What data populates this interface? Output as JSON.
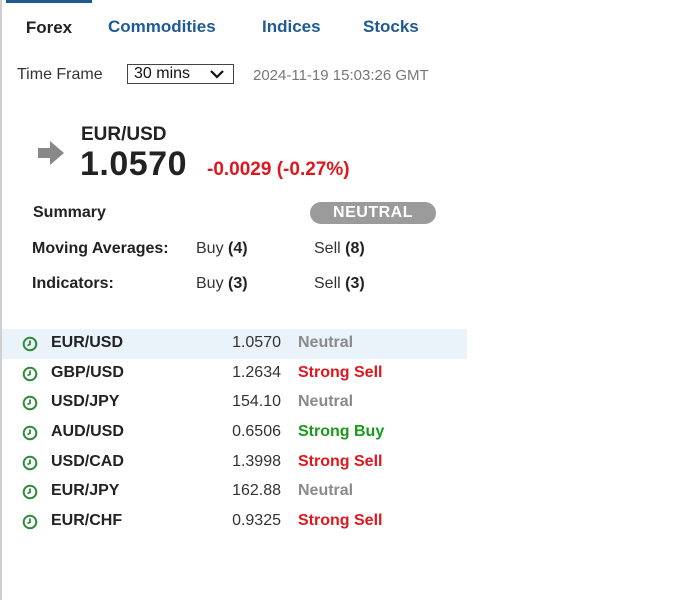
{
  "tabs": [
    {
      "label": "Forex",
      "active": true
    },
    {
      "label": "Commodities",
      "active": false
    },
    {
      "label": "Indices",
      "active": false
    },
    {
      "label": "Stocks",
      "active": false
    }
  ],
  "timeframe": {
    "label": "Time Frame",
    "selected": "30 mins",
    "timestamp": "2024-11-19 15:03:26 GMT"
  },
  "pair": {
    "name": "EUR/USD",
    "price": "1.0570",
    "change": "-0.0029 (-0.27%)",
    "icon": "arrow-right-icon"
  },
  "summary": {
    "label": "Summary",
    "badge": "NEUTRAL",
    "moving_averages": {
      "label": "Moving Averages:",
      "buy_text": "Buy",
      "buy_count": "(4)",
      "sell_text": "Sell",
      "sell_count": "(8)"
    },
    "indicators": {
      "label": "Indicators:",
      "buy_text": "Buy",
      "buy_count": "(3)",
      "sell_text": "Sell",
      "sell_count": "(3)"
    }
  },
  "quotes": [
    {
      "pair": "EUR/USD",
      "price": "1.0570",
      "signal": "Neutral"
    },
    {
      "pair": "GBP/USD",
      "price": "1.2634",
      "signal": "Strong Sell"
    },
    {
      "pair": "USD/JPY",
      "price": "154.10",
      "signal": "Neutral"
    },
    {
      "pair": "AUD/USD",
      "price": "0.6506",
      "signal": "Strong Buy"
    },
    {
      "pair": "USD/CAD",
      "price": "1.3998",
      "signal": "Strong Sell"
    },
    {
      "pair": "EUR/JPY",
      "price": "162.88",
      "signal": "Neutral"
    },
    {
      "pair": "EUR/CHF",
      "price": "0.9325",
      "signal": "Strong Sell"
    }
  ],
  "colors": {
    "tab_blue": "#1f5a96",
    "sell_red": "#e0161c",
    "buy_green": "#1a9a1a",
    "neutral_gray": "#8a8a8a",
    "clock_green": "#2e8b3a",
    "badge_gray": "#9b9b9b"
  }
}
